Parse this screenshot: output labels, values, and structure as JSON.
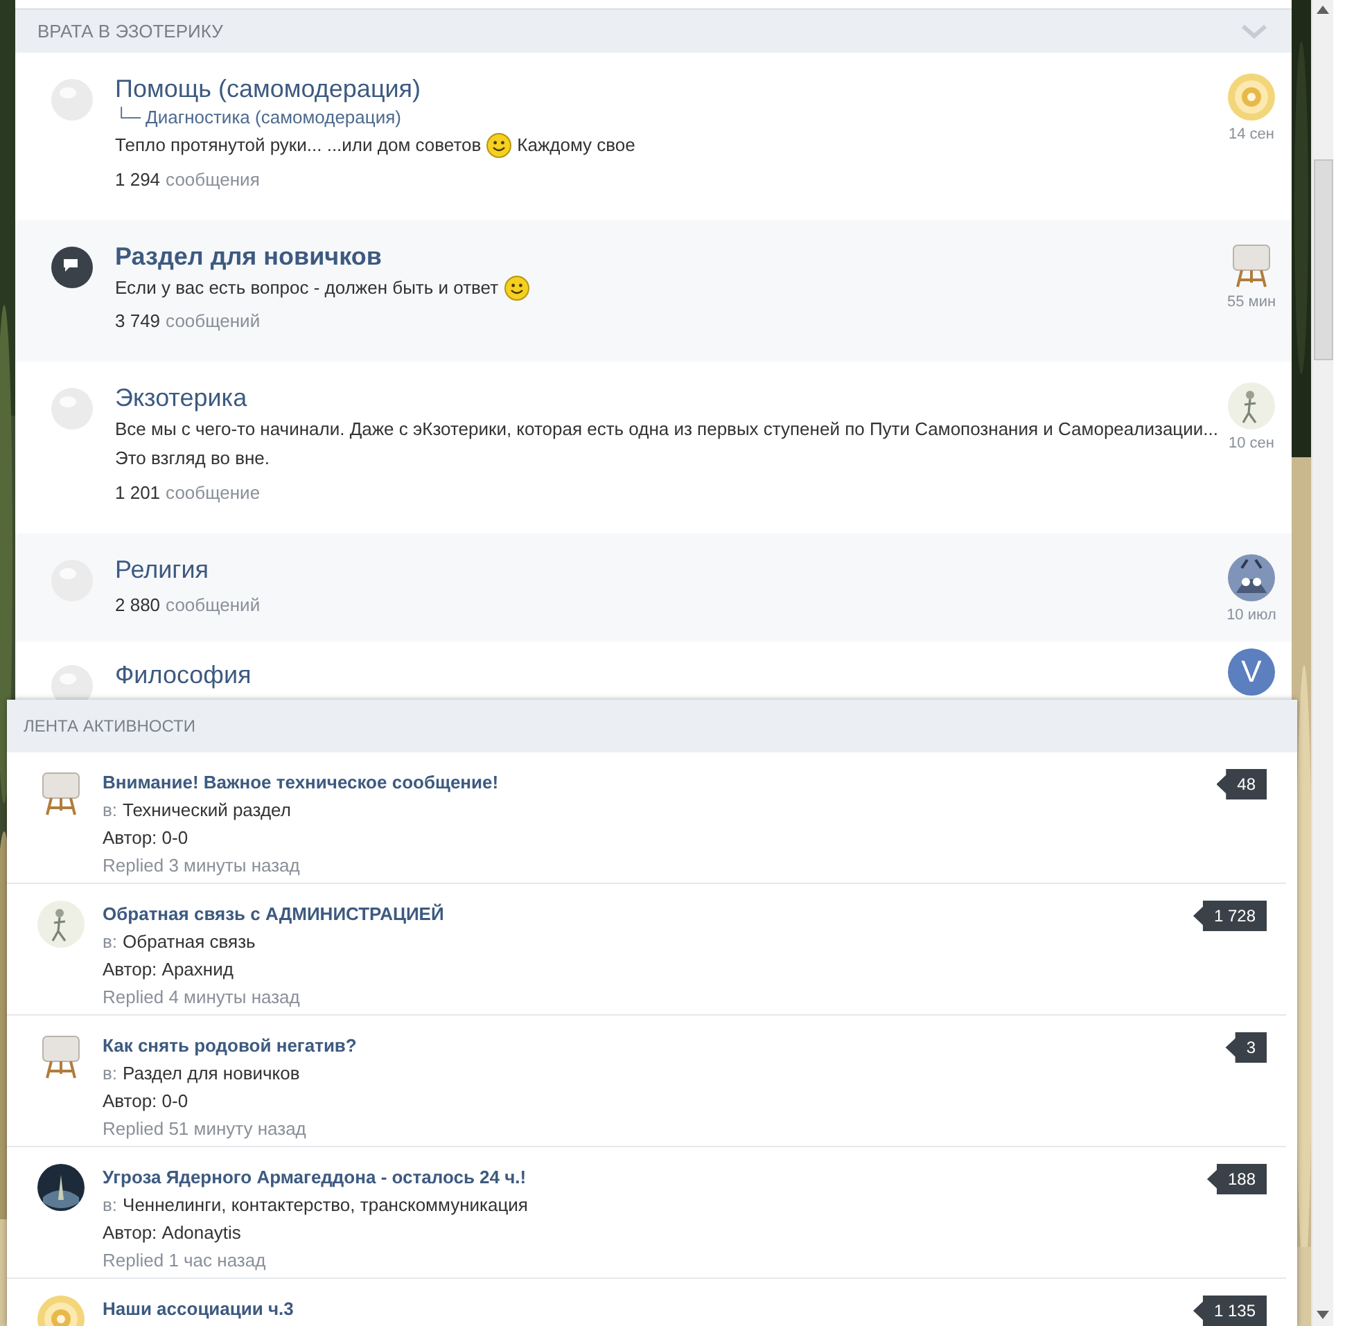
{
  "category": {
    "title": "ВРАТА В ЭЗОТЕРИКУ",
    "expanded": true
  },
  "forums": [
    {
      "title": "Помощь (самомодерация)",
      "unread": false,
      "subforums": [
        "└─ Диагностика (самомодерация)"
      ],
      "lines": [
        [
          {
            "kind": "text",
            "text": "Тепло протянутой руки... ...или дом советов"
          },
          {
            "kind": "smiley"
          },
          {
            "kind": "text",
            "text": "Каждому свое"
          }
        ]
      ],
      "count": "1 294",
      "count_label": "сообщения",
      "avatar": {
        "kind": "spiral"
      },
      "time": "14 сен"
    },
    {
      "title": "Раздел для новичков",
      "unread": true,
      "lines": [
        [
          {
            "kind": "text",
            "text": "Если у вас есть вопрос - должен быть и ответ"
          },
          {
            "kind": "smiley"
          }
        ]
      ],
      "count": "3 749",
      "count_label": "сообщений",
      "avatar": {
        "kind": "easel"
      },
      "time": "55 мин"
    },
    {
      "title": "Экзотерика",
      "unread": false,
      "lines": [
        [
          {
            "kind": "text",
            "text": "Все мы с чего-то начинали. Даже с эКзотерики, которая есть одна из первых ступеней по Пути Самопознания и Самореализации..."
          }
        ],
        [
          {
            "kind": "text",
            "text": "Это взгляд во вне."
          }
        ]
      ],
      "count": "1 201",
      "count_label": "сообщение",
      "avatar": {
        "kind": "figure"
      },
      "time": "10 сен"
    },
    {
      "title": "Религия",
      "unread": false,
      "count": "2 880",
      "count_label": "сообщений",
      "avatar": {
        "kind": "creature"
      },
      "time": "10 июл"
    },
    {
      "title": "Философия",
      "unread": false,
      "avatar": {
        "kind": "letter",
        "letter": "V"
      }
    }
  ],
  "activity": {
    "title": "ЛЕНТА АКТИВНОСТИ",
    "items": [
      {
        "title": "Внимание! Важное техническое сообщение!",
        "in_label": "в:",
        "forum": "Технический раздел",
        "author": "Автор: 0-0",
        "replied": "Replied 3 минуты назад",
        "replies": "48",
        "avatar": {
          "kind": "easel"
        }
      },
      {
        "title": "Обратная связь с АДМИНИСТРАЦИЕЙ",
        "in_label": "в:",
        "forum": "Обратная связь",
        "author": "Автор: Арахнид",
        "replied": "Replied 4 минуты назад",
        "replies": "1 728",
        "avatar": {
          "kind": "figure"
        }
      },
      {
        "title": "Как снять родовой негатив?",
        "in_label": "в:",
        "forum": "Раздел для новичков",
        "author": "Автор: 0-0",
        "replied": "Replied 51 минуту назад",
        "replies": "3",
        "avatar": {
          "kind": "easel"
        }
      },
      {
        "title": "Угроза Ядерного Армагеддона - осталось 24 ч.!",
        "in_label": "в:",
        "forum": "Ченнелинги, контактерство, транскоммуникация",
        "author": "Автор: Adonaytis",
        "replied": "Replied 1 час назад",
        "replies": "188",
        "avatar": {
          "kind": "dark"
        }
      },
      {
        "title": "Наши ассоциации ч.3",
        "replies": "1 135",
        "avatar": {
          "kind": "spiral"
        }
      }
    ]
  }
}
